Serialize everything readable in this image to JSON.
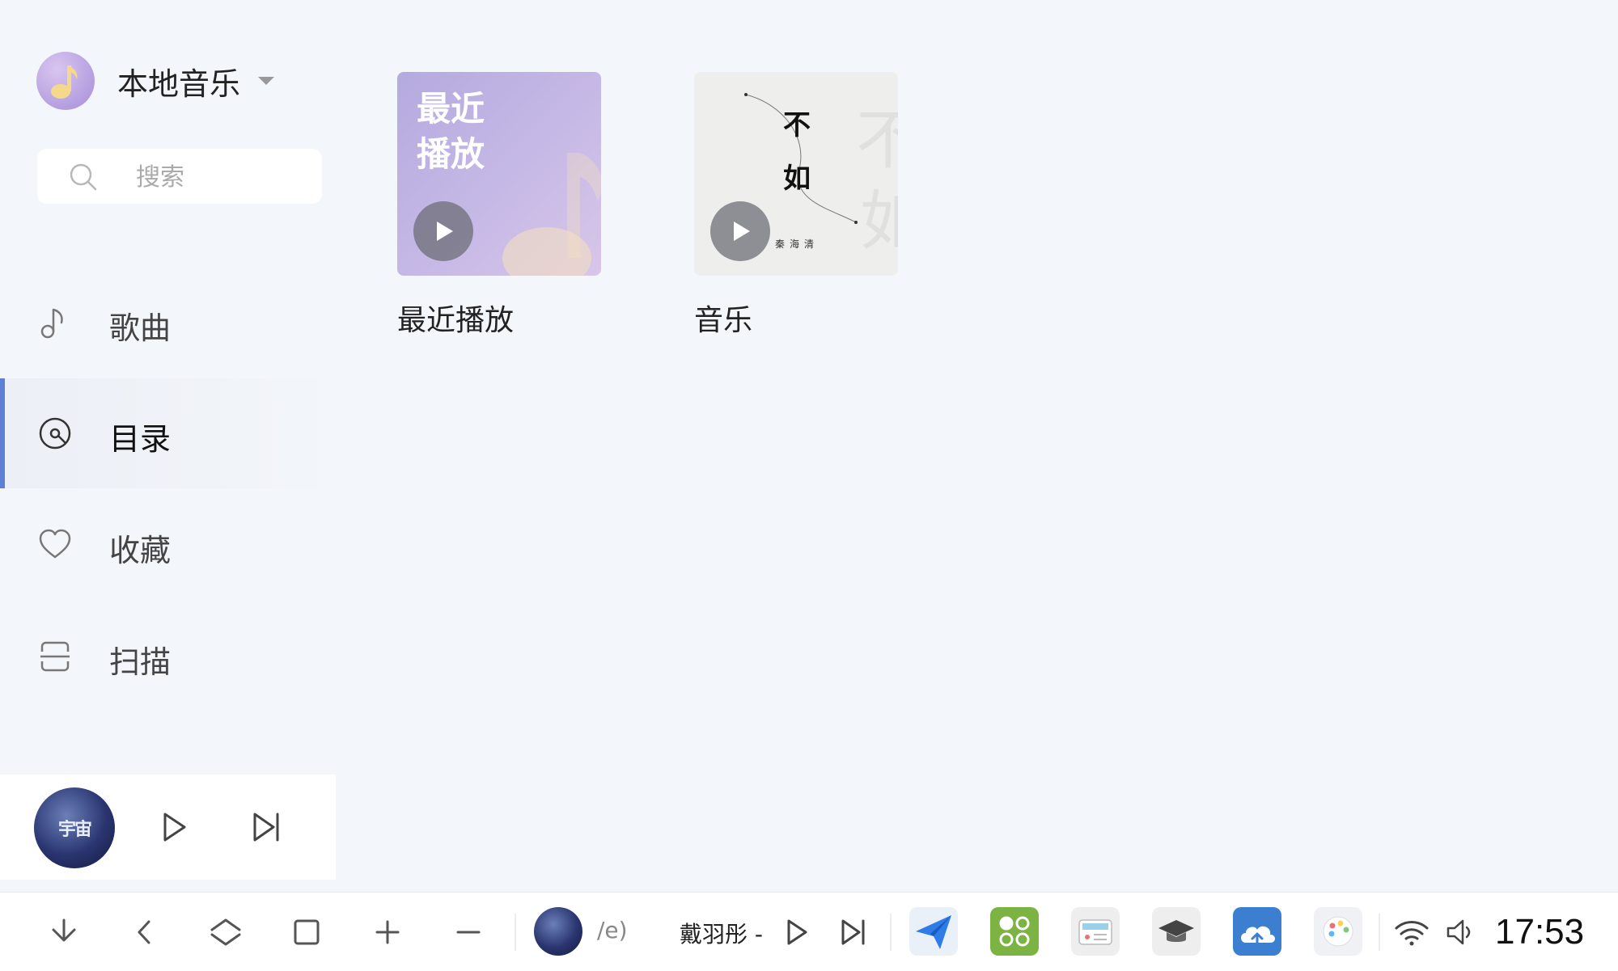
{
  "sidebar": {
    "source_title": "本地音乐",
    "search_placeholder": "搜索",
    "nav": [
      {
        "label": "歌曲",
        "icon": "music-note-icon"
      },
      {
        "label": "目录",
        "icon": "disc-icon"
      },
      {
        "label": "收藏",
        "icon": "heart-icon"
      },
      {
        "label": "扫描",
        "icon": "scan-icon"
      }
    ],
    "active_nav": "目录"
  },
  "content": {
    "albums": [
      {
        "title": "最近播放",
        "cover_text": [
          "最近",
          "播放"
        ]
      },
      {
        "title": "音乐",
        "cover_text": [
          "不",
          "如"
        ],
        "cover_small": "秦海清"
      }
    ]
  },
  "mini_player": {
    "cover_text": "宇宙"
  },
  "taskbar": {
    "track_partial": "/e)",
    "artist": "戴羽彤 -",
    "clock": "17:53"
  },
  "colors": {
    "accent": "#5d7fd6",
    "background": "#f3f6fb",
    "panel": "#ffffff"
  }
}
